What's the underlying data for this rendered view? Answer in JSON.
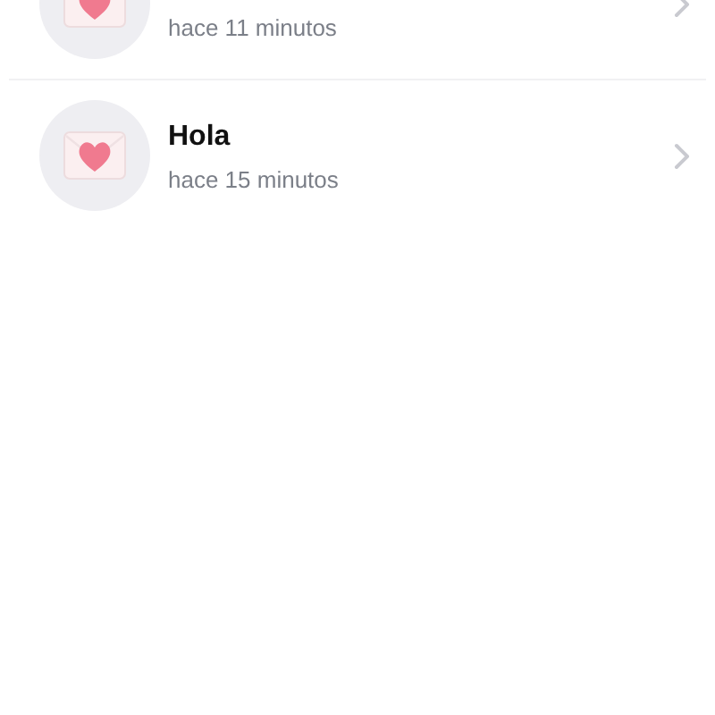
{
  "messages": [
    {
      "time": "hace 11 minutos"
    },
    {
      "title": "Hola",
      "time": "hace 15 minutos"
    }
  ]
}
